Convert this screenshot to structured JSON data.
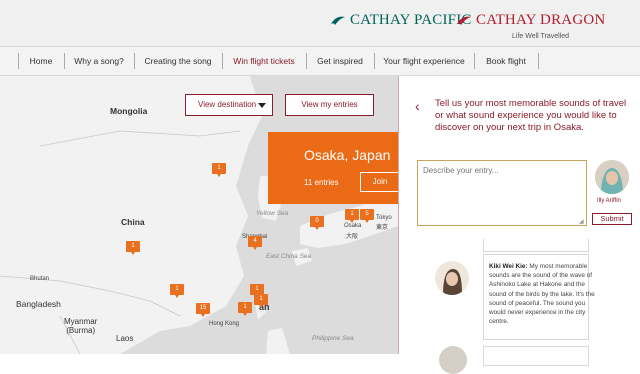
{
  "header": {
    "brand1": "CATHAY PACIFIC",
    "brand2": "CATHAY DRAGON",
    "tagline": "Life Well Travelled",
    "colors": {
      "pacific_green": "#00645a",
      "dragon_red": "#b01e2f"
    }
  },
  "nav": {
    "items": [
      {
        "label": "Home"
      },
      {
        "label": "Why a song?"
      },
      {
        "label": "Creating the song"
      },
      {
        "label": "Win flight tickets"
      },
      {
        "label": "Get inspired"
      },
      {
        "label": "Your flight experience"
      },
      {
        "label": "Book flight"
      }
    ]
  },
  "map": {
    "view_destination": "View destination",
    "view_entries": "View my entries",
    "labels": {
      "mongolia": "Mongolia",
      "china": "China",
      "bhutan": "Bhutan",
      "bangladesh": "Bangladesh",
      "myanmar": "Myanmar\n(Burma)",
      "laos": "Laos",
      "hongkong": "Hong Kong",
      "shanghai": "Shanghai",
      "yellow_sea": "Yellow Sea",
      "east_china_sea": "East China Sea",
      "philippine_sea": "Philippine Sea",
      "osaka": "Osaka",
      "osaka_jp": "大阪",
      "tokyo": "Tokyo",
      "tokyo_jp": "東京",
      "taiwan_partial": "an"
    },
    "markers": [
      "1",
      "1",
      "1",
      "4",
      "0",
      "1",
      "1",
      "1",
      "15",
      "1",
      "5"
    ],
    "popup": {
      "title": "Osaka, Japan",
      "entries": "11 entries",
      "join": "Join"
    },
    "accent": "#e8701e"
  },
  "panel": {
    "prompt": "Tell us your most memorable sounds of travel or what sound experience you would like to discover on your next trip in Osaka.",
    "placeholder": "Describe your entry...",
    "user_name": "Illy Ariffin",
    "submit": "Submit",
    "comment": {
      "author": "Kiki Wei Kie:",
      "text": " My most memorable sounds are the sound of the wave of Ashinoko Lake at Hakone and the sound of the birds by the lake. It's the sound of peaceful. The sound you would never experience in the city centre."
    },
    "accent": "#8a1c2b"
  }
}
